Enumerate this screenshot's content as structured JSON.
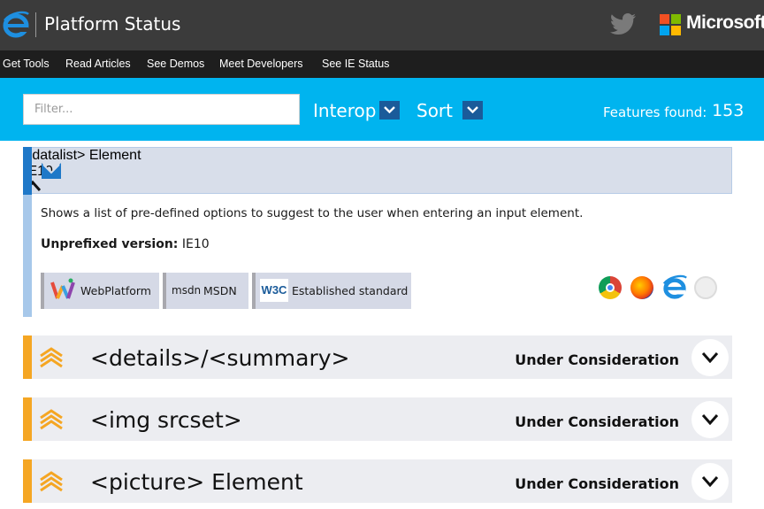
{
  "header": {
    "site_title": "Platform Status",
    "brand_name": "Microsoft",
    "colors": {
      "bar": "#3b3b3b",
      "ie_blue": "#1e8fe0"
    }
  },
  "nav": {
    "items": [
      "Get Tools",
      "Read Articles",
      "See Demos",
      "Meet Developers",
      "See IE Status"
    ]
  },
  "filter": {
    "placeholder": "Filter...",
    "interop_label": "Interop",
    "sort_label": "Sort",
    "features_found_label": "Features found:",
    "features_found_count": "153",
    "accent": "#00b4ef"
  },
  "features": [
    {
      "name": "<datalist> Element",
      "status": "IE10+",
      "category_icon": "html5-element-icon",
      "expanded": true,
      "description": "Shows a list of pre-defined options to suggest to the user when entering an input element.",
      "unprefixed_label": "Unprefixed version:",
      "unprefixed_value": "IE10",
      "links": [
        {
          "label": "WebPlatform",
          "icon": "webplatform-icon"
        },
        {
          "label": "MSDN",
          "icon_text": "msdn",
          "icon": "msdn-icon"
        },
        {
          "label": "Established standard",
          "icon_text": "W3C",
          "icon": "w3c-icon"
        }
      ],
      "browsers": [
        "chrome-icon",
        "firefox-icon",
        "ie-icon",
        "opera-icon"
      ],
      "accent": "#1e78c8"
    },
    {
      "name": "<details>/<summary>",
      "status": "Under Consideration",
      "category_icon": "chevrons-up-icon",
      "expanded": false,
      "accent": "#f5a623"
    },
    {
      "name": "<img srcset>",
      "status": "Under Consideration",
      "category_icon": "chevrons-up-icon",
      "expanded": false,
      "accent": "#f5a623"
    },
    {
      "name": "<picture> Element",
      "status": "Under Consideration",
      "category_icon": "chevrons-up-icon",
      "expanded": false,
      "accent": "#f5a623"
    }
  ]
}
